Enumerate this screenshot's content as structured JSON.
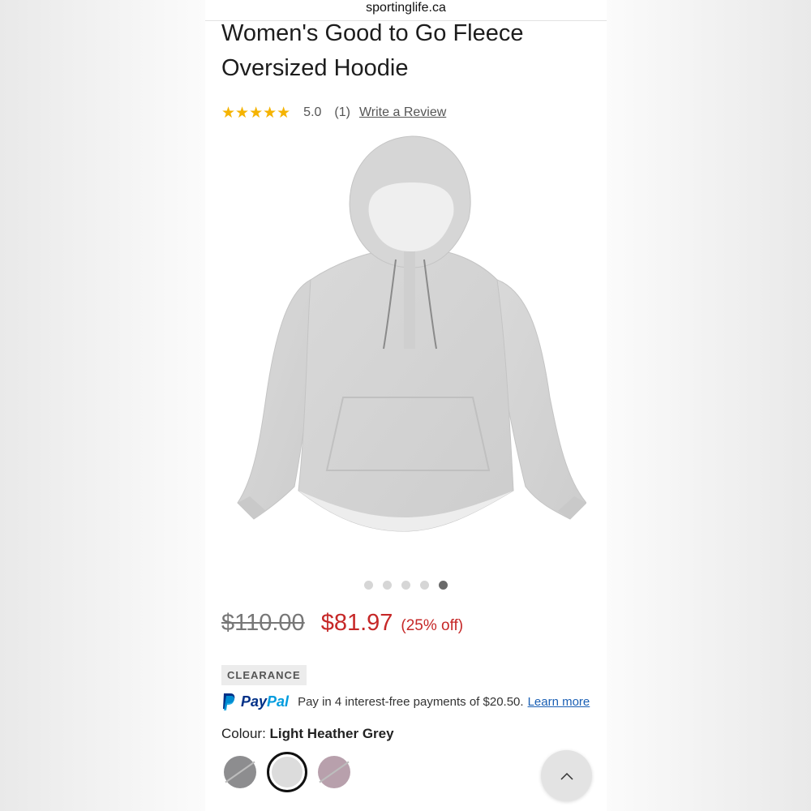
{
  "browser": {
    "url": "sportinglife.ca"
  },
  "product": {
    "title": "Women's Good to Go Fleece Oversized Hoodie",
    "rating": {
      "stars": "★★★★★",
      "value": "5.0",
      "count": "(1)",
      "write_review_label": "Write a Review"
    },
    "image": {
      "total": 5,
      "active_index": 4
    },
    "price": {
      "original": "$110.00",
      "sale": "$81.97",
      "discount": "(25% off)"
    },
    "badge": "CLEARANCE",
    "paypal": {
      "brand_pay": "Pay",
      "brand_pal": "Pal",
      "message": "Pay in 4 interest-free payments of $20.50.",
      "learn_more": "Learn more"
    },
    "colour": {
      "label": "Colour:",
      "selected": "Light Heather Grey",
      "swatches": [
        {
          "name": "dark-grey",
          "color": "#8d8d8f",
          "unavailable": true
        },
        {
          "name": "light-heather-grey",
          "color": "#dcdcdc",
          "unavailable": false,
          "selected": true
        },
        {
          "name": "mauve",
          "color": "#b8a0ac",
          "unavailable": true
        }
      ]
    }
  },
  "controls": {
    "scroll_top_icon": "chevron-up-icon"
  },
  "colors": {
    "sale_red": "#c62828",
    "star_gold": "#f5b301",
    "paypal_blue": "#003087",
    "paypal_light": "#009cde",
    "link_blue": "#1a5fb4"
  }
}
